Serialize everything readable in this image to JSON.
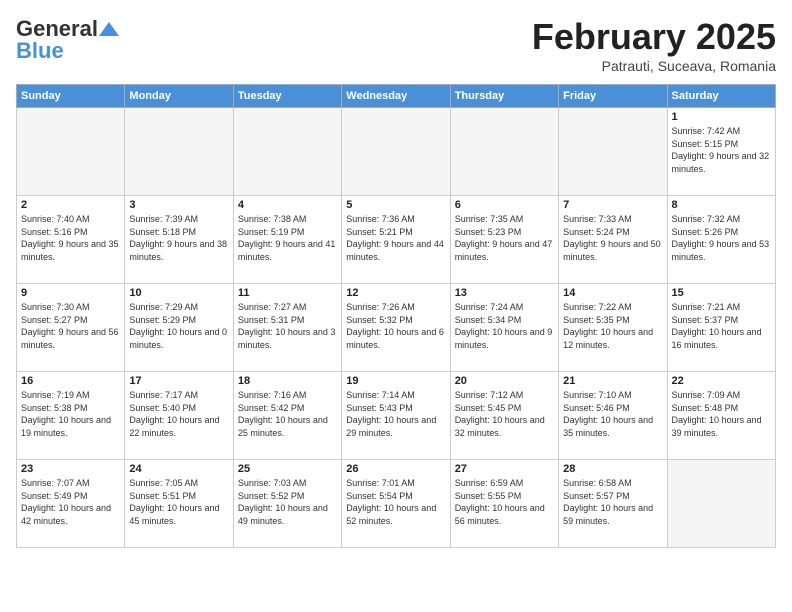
{
  "logo": {
    "general": "General",
    "blue": "Blue"
  },
  "header": {
    "month": "February 2025",
    "location": "Patrauti, Suceava, Romania"
  },
  "weekdays": [
    "Sunday",
    "Monday",
    "Tuesday",
    "Wednesday",
    "Thursday",
    "Friday",
    "Saturday"
  ],
  "weeks": [
    [
      {
        "day": "",
        "info": ""
      },
      {
        "day": "",
        "info": ""
      },
      {
        "day": "",
        "info": ""
      },
      {
        "day": "",
        "info": ""
      },
      {
        "day": "",
        "info": ""
      },
      {
        "day": "",
        "info": ""
      },
      {
        "day": "1",
        "info": "Sunrise: 7:42 AM\nSunset: 5:15 PM\nDaylight: 9 hours and 32 minutes."
      }
    ],
    [
      {
        "day": "2",
        "info": "Sunrise: 7:40 AM\nSunset: 5:16 PM\nDaylight: 9 hours and 35 minutes."
      },
      {
        "day": "3",
        "info": "Sunrise: 7:39 AM\nSunset: 5:18 PM\nDaylight: 9 hours and 38 minutes."
      },
      {
        "day": "4",
        "info": "Sunrise: 7:38 AM\nSunset: 5:19 PM\nDaylight: 9 hours and 41 minutes."
      },
      {
        "day": "5",
        "info": "Sunrise: 7:36 AM\nSunset: 5:21 PM\nDaylight: 9 hours and 44 minutes."
      },
      {
        "day": "6",
        "info": "Sunrise: 7:35 AM\nSunset: 5:23 PM\nDaylight: 9 hours and 47 minutes."
      },
      {
        "day": "7",
        "info": "Sunrise: 7:33 AM\nSunset: 5:24 PM\nDaylight: 9 hours and 50 minutes."
      },
      {
        "day": "8",
        "info": "Sunrise: 7:32 AM\nSunset: 5:26 PM\nDaylight: 9 hours and 53 minutes."
      }
    ],
    [
      {
        "day": "9",
        "info": "Sunrise: 7:30 AM\nSunset: 5:27 PM\nDaylight: 9 hours and 56 minutes."
      },
      {
        "day": "10",
        "info": "Sunrise: 7:29 AM\nSunset: 5:29 PM\nDaylight: 10 hours and 0 minutes."
      },
      {
        "day": "11",
        "info": "Sunrise: 7:27 AM\nSunset: 5:31 PM\nDaylight: 10 hours and 3 minutes."
      },
      {
        "day": "12",
        "info": "Sunrise: 7:26 AM\nSunset: 5:32 PM\nDaylight: 10 hours and 6 minutes."
      },
      {
        "day": "13",
        "info": "Sunrise: 7:24 AM\nSunset: 5:34 PM\nDaylight: 10 hours and 9 minutes."
      },
      {
        "day": "14",
        "info": "Sunrise: 7:22 AM\nSunset: 5:35 PM\nDaylight: 10 hours and 12 minutes."
      },
      {
        "day": "15",
        "info": "Sunrise: 7:21 AM\nSunset: 5:37 PM\nDaylight: 10 hours and 16 minutes."
      }
    ],
    [
      {
        "day": "16",
        "info": "Sunrise: 7:19 AM\nSunset: 5:38 PM\nDaylight: 10 hours and 19 minutes."
      },
      {
        "day": "17",
        "info": "Sunrise: 7:17 AM\nSunset: 5:40 PM\nDaylight: 10 hours and 22 minutes."
      },
      {
        "day": "18",
        "info": "Sunrise: 7:16 AM\nSunset: 5:42 PM\nDaylight: 10 hours and 25 minutes."
      },
      {
        "day": "19",
        "info": "Sunrise: 7:14 AM\nSunset: 5:43 PM\nDaylight: 10 hours and 29 minutes."
      },
      {
        "day": "20",
        "info": "Sunrise: 7:12 AM\nSunset: 5:45 PM\nDaylight: 10 hours and 32 minutes."
      },
      {
        "day": "21",
        "info": "Sunrise: 7:10 AM\nSunset: 5:46 PM\nDaylight: 10 hours and 35 minutes."
      },
      {
        "day": "22",
        "info": "Sunrise: 7:09 AM\nSunset: 5:48 PM\nDaylight: 10 hours and 39 minutes."
      }
    ],
    [
      {
        "day": "23",
        "info": "Sunrise: 7:07 AM\nSunset: 5:49 PM\nDaylight: 10 hours and 42 minutes."
      },
      {
        "day": "24",
        "info": "Sunrise: 7:05 AM\nSunset: 5:51 PM\nDaylight: 10 hours and 45 minutes."
      },
      {
        "day": "25",
        "info": "Sunrise: 7:03 AM\nSunset: 5:52 PM\nDaylight: 10 hours and 49 minutes."
      },
      {
        "day": "26",
        "info": "Sunrise: 7:01 AM\nSunset: 5:54 PM\nDaylight: 10 hours and 52 minutes."
      },
      {
        "day": "27",
        "info": "Sunrise: 6:59 AM\nSunset: 5:55 PM\nDaylight: 10 hours and 56 minutes."
      },
      {
        "day": "28",
        "info": "Sunrise: 6:58 AM\nSunset: 5:57 PM\nDaylight: 10 hours and 59 minutes."
      },
      {
        "day": "",
        "info": ""
      }
    ]
  ]
}
